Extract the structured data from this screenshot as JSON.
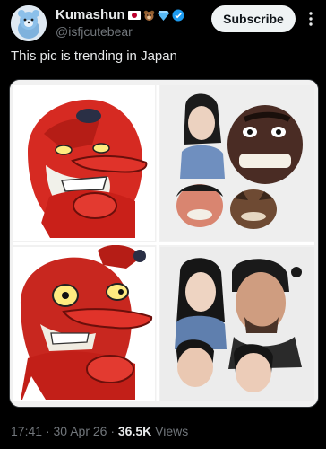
{
  "author": {
    "display_name": "Kumashun",
    "handle": "@isfjcutebear",
    "icons": [
      "japan-flag-icon",
      "bear-face-icon",
      "blue-gem-icon",
      "verified-badge-icon"
    ]
  },
  "actions": {
    "subscribe_label": "Subscribe"
  },
  "tweet": {
    "text": "This pic is trending in Japan"
  },
  "media": {
    "kind": "4-panel meme image",
    "panels": [
      "tengu-grinning",
      "young-faces",
      "tengu-shocked",
      "adult-faces"
    ]
  },
  "meta": {
    "time": "17:41",
    "date": "30 Apr 26",
    "views_count": "36.5K",
    "views_label": "Views"
  },
  "colors": {
    "background": "#000000",
    "text_primary": "#e7e9ea",
    "text_secondary": "#71767b",
    "subscribe_bg": "#eff3f4",
    "verified_blue": "#1d9bf0"
  }
}
